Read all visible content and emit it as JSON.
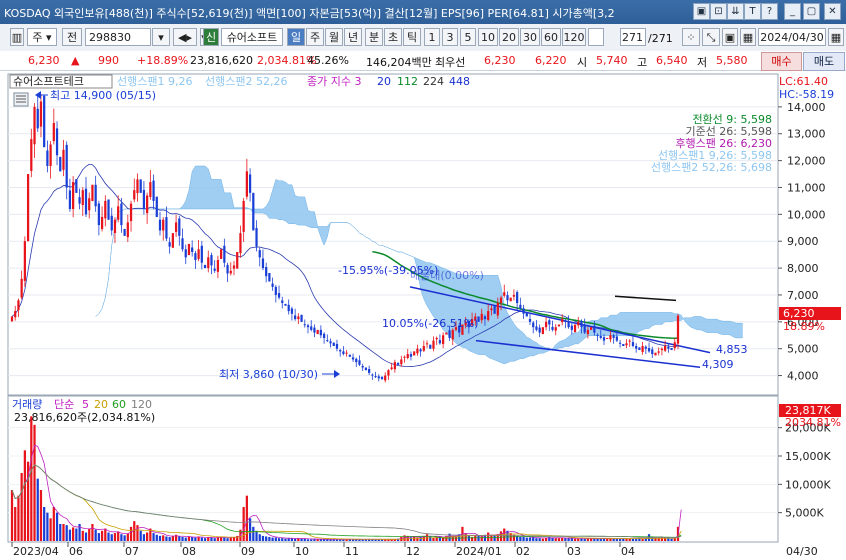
{
  "title_bar": {
    "text": "KOSDAQ 외국인보유[488(천)] 주식수[52,619(천)] 액면[100] 자본금[53(억)] 결산[12월] EPS[96] PER[64.81] 시가총액[3,2",
    "buttons": [
      "▣",
      "⊡",
      "⇊",
      "T",
      "?",
      "_",
      "▢",
      "✕"
    ]
  },
  "toolbar": {
    "market_label": "주",
    "all_label": "전",
    "code": "298830",
    "stock_name_tag": "신",
    "stock_name": "슈어소프트",
    "periods": [
      "일",
      "주",
      "월",
      "년",
      "분",
      "초",
      "틱"
    ],
    "active_period": "일",
    "intervals": [
      "1",
      "3",
      "5",
      "10",
      "20",
      "30",
      "60",
      "120"
    ],
    "count": "271",
    "count_total": "/271",
    "date": "2024/04/30"
  },
  "info": {
    "price": "6,230",
    "price_arrow": "▲",
    "change": "990",
    "change_pct": "+18.89%",
    "volume": "23,816,620",
    "volume_pct": "2,034.81%",
    "turnover": "45.26%",
    "amount": "146,204백만",
    "best_bid_label": "최우선",
    "best_ask": "6,230",
    "best_bid": "6,220",
    "open_label": "시",
    "open": "5,740",
    "high_label": "고",
    "high": "6,540",
    "low_label": "저",
    "low": "5,580",
    "buy_label": "매수",
    "sell_label": "매도"
  },
  "legend": {
    "name": "슈어소프트테크",
    "span1": "선행스팬1 9,26",
    "span2": "선행스팬2 52,26",
    "close_ma": "종가 지수 3",
    "ma_values": [
      "20",
      "112",
      "224",
      "448"
    ],
    "lc": "LC:61.40",
    "hc": "HC:-58.19"
  },
  "ichimoku_legend": [
    {
      "text": "전환선 9: 5,598",
      "color": "#0a8a2a"
    },
    {
      "text": "기준선 26: 5,598",
      "color": "#555555"
    },
    {
      "text": "후행스팬 26: 6,230",
      "color": "#b01ab0"
    },
    {
      "text": "선행스팬1 9,26: 5,598",
      "color": "#8ec6f0"
    },
    {
      "text": "선행스팬2 52,26: 5,698",
      "color": "#8ec6f0"
    }
  ],
  "annotations": {
    "high_marker": "최고 14,900 (05/15)",
    "low_marker": "최저 3,860 (10/30)",
    "pct1": "-15.95%(-39.05%)",
    "pct2": "10.05%(-26.51%)",
    "line_a": "4,853",
    "line_b": "4,309",
    "other_label": "매물대(0.00%)"
  },
  "price_axis": {
    "ticks": [
      "14,000",
      "13,000",
      "12,000",
      "11,000",
      "10,000",
      "9,000",
      "8,000",
      "7,000",
      "6,000",
      "5,000",
      "4,000"
    ],
    "current": "6,230",
    "current_pct": "18.89%"
  },
  "volume_panel": {
    "title": "거래량",
    "ma_label": "단순",
    "ma_values": [
      "5",
      "20",
      "60",
      "120"
    ],
    "ma_colors": [
      "#c020c0",
      "#c8a000",
      "#20a020",
      "#808080"
    ],
    "value": "23,816,620주(2,034.81%)",
    "axis_ticks": [
      "20,000K",
      "15,000K",
      "10,000K",
      "5,000K"
    ],
    "current": "23,817K",
    "current_pct": "2034.81%"
  },
  "date_axis": [
    "2023/04",
    "06",
    "07",
    "08",
    "09",
    "10",
    "11",
    "12",
    "2024/01",
    "02",
    "03",
    "04",
    "04/30"
  ],
  "colors": {
    "up": "#e8141b",
    "down": "#1a3fd6",
    "cloud": "#8ec6f0",
    "baseline": "#0a8a2a",
    "channel": "#1a30d0"
  },
  "chart_data": {
    "type": "candlestick",
    "period": "daily",
    "x_range": [
      "2023/04",
      "2024/04/30"
    ],
    "y_range": [
      3500,
      15000
    ],
    "closes": [
      6200,
      6400,
      6800,
      7600,
      9000,
      11500,
      12800,
      14000,
      13200,
      14200,
      12500,
      11800,
      12600,
      13400,
      12200,
      11600,
      12400,
      11000,
      10200,
      11200,
      10800,
      10400,
      10900,
      10000,
      10600,
      11100,
      10300,
      9600,
      9900,
      10500,
      9800,
      9400,
      9800,
      10300,
      9600,
      9200,
      9700,
      10400,
      10900,
      11300,
      10800,
      10200,
      10700,
      11200,
      10500,
      9900,
      9400,
      9800,
      9100,
      8800,
      9300,
      9700,
      9200,
      8700,
      8400,
      8900,
      8600,
      8300,
      8700,
      8200,
      8000,
      8400,
      8100,
      7900,
      8300,
      8700,
      8200,
      7800,
      7900,
      8100,
      8600,
      9300,
      10500,
      11600,
      10800,
      9400,
      8800,
      8400,
      8000,
      7700,
      7500,
      7300,
      7000,
      6900,
      6700,
      6600,
      6400,
      6300,
      6100,
      6200,
      6000,
      5900,
      5800,
      5700,
      5600,
      5700,
      5500,
      5400,
      5300,
      5200,
      5100,
      5000,
      4900,
      4800,
      4850,
      4700,
      4600,
      4500,
      4400,
      4300,
      4200,
      4100,
      4000,
      3950,
      3900,
      3860,
      4000,
      4200,
      4300,
      4500,
      4400,
      4600,
      4700,
      4800,
      4700,
      4900,
      5000,
      4900,
      5100,
      5200,
      5000,
      5300,
      5400,
      5200,
      5500,
      5600,
      5400,
      5700,
      5800,
      5600,
      5900,
      6000,
      5800,
      6100,
      6200,
      6000,
      6300,
      6100,
      6400,
      6500,
      6300,
      6700,
      6900,
      7100,
      6800,
      6900,
      7000,
      6700,
      6500,
      6300,
      6200,
      6000,
      5800,
      5700,
      5600,
      5800,
      6000,
      5900,
      5700,
      5800,
      5900,
      6100,
      6000,
      5800,
      5700,
      5900,
      6000,
      5800,
      5600,
      5700,
      5800,
      5600,
      5500,
      5400,
      5300,
      5400,
      5500,
      5400,
      5300,
      5200,
      5100,
      5200,
      5300,
      5100,
      5000,
      4950,
      5100,
      5000,
      4900,
      4800,
      4850,
      4900,
      5000,
      5100,
      5000,
      4950,
      5240,
      6230
    ],
    "volume_k": [
      9000,
      6000,
      8000,
      12000,
      16000,
      14000,
      22000,
      20500,
      11000,
      9000,
      6000,
      5000,
      4000,
      6000,
      5000,
      3000,
      3000,
      2800,
      2000,
      2400,
      2200,
      3000,
      1800,
      1500,
      2200,
      3000,
      2000,
      1400,
      1800,
      2200,
      1500,
      1200,
      1400,
      1700,
      1200,
      1000,
      1300,
      2500,
      3500,
      2800,
      1800,
      1200,
      1500,
      2200,
      1400,
      1100,
      900,
      1000,
      800,
      700,
      900,
      1100,
      800,
      700,
      600,
      800,
      700,
      600,
      800,
      600,
      500,
      700,
      600,
      500,
      700,
      800,
      600,
      500,
      600,
      700,
      900,
      2000,
      6000,
      8000,
      4000,
      2500,
      1800,
      1200,
      900,
      800,
      700,
      600,
      600,
      500,
      500,
      400,
      500,
      500,
      400,
      500,
      400,
      400,
      300,
      300,
      400,
      300,
      300,
      300,
      300,
      300,
      300,
      300,
      300,
      300,
      300,
      300,
      300,
      300,
      300,
      300,
      300,
      300,
      300,
      300,
      300,
      300,
      300,
      300,
      300,
      300,
      400,
      700,
      1000,
      800,
      600,
      700,
      600,
      700,
      900,
      1200,
      800,
      600,
      700,
      800,
      600,
      900,
      1300,
      800,
      700,
      1200,
      2500,
      1400,
      900,
      700,
      1000,
      900,
      800,
      1100,
      1500,
      1000,
      900,
      1200,
      1700,
      2200,
      1800,
      1400,
      1100,
      900,
      800,
      700,
      600,
      600,
      700,
      500,
      500,
      400,
      600,
      700,
      600,
      500,
      500,
      600,
      500,
      500,
      500,
      400,
      400,
      500,
      400,
      400,
      400,
      400,
      500,
      400,
      400,
      400,
      400,
      400,
      400,
      400,
      500,
      400,
      400,
      400,
      400,
      500,
      400,
      500,
      1200,
      700,
      600,
      500,
      600,
      500,
      500,
      400,
      500,
      2500,
      23817
    ]
  }
}
